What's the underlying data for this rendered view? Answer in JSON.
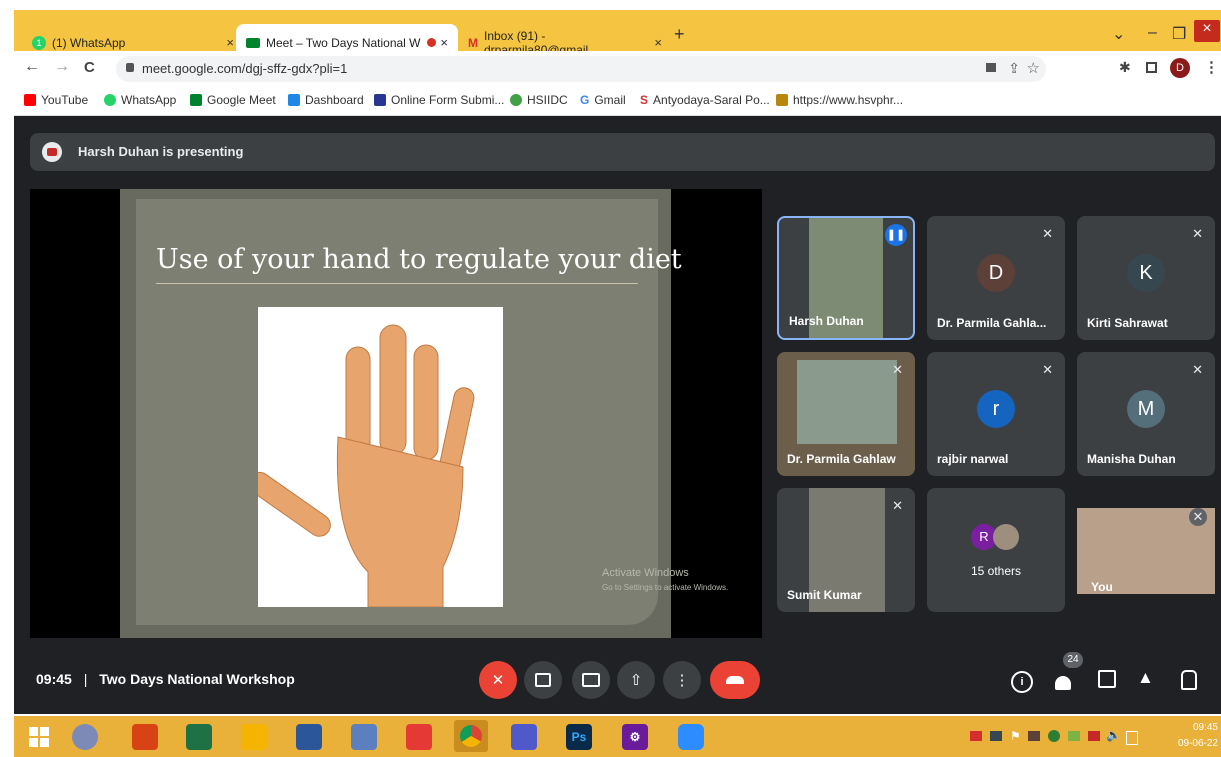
{
  "tabs": [
    {
      "label": "(1) WhatsApp",
      "badge": "1"
    },
    {
      "label": "Meet – Two Days National W"
    },
    {
      "label": "Inbox (91) - drparmila80@gmail."
    }
  ],
  "new_tab": "+",
  "close_glyph": "×",
  "window": {
    "minimize": "–",
    "restore": "❐",
    "close": "×",
    "dropdown": "⌄"
  },
  "nav": {
    "back": "←",
    "forward": "→",
    "reload": "C"
  },
  "address": "meet.google.com/dgj-sffz-gdx?pli=1",
  "profile_initial": "D",
  "bookmarks": [
    "YouTube",
    "WhatsApp",
    "Google Meet",
    "Dashboard",
    "Online Form Submi...",
    "HSIIDC",
    "Gmail",
    "Antyodaya-Saral Po...",
    "https://www.hsvphr..."
  ],
  "presenting": "Harsh Duhan is presenting",
  "slide": {
    "title": "Use of your hand to regulate your diet",
    "watermark_title": "Activate Windows",
    "watermark_sub": "Go to Settings to activate Windows."
  },
  "participants": [
    {
      "name": "Harsh Duhan",
      "type": "video",
      "speaking": true
    },
    {
      "name": "Dr. Parmila Gahla...",
      "initial": "D",
      "color": "#5d4037"
    },
    {
      "name": "Kirti Sahrawat",
      "initial": "K",
      "color": "#37474f"
    },
    {
      "name": "Dr. Parmila Gahlaw",
      "type": "video"
    },
    {
      "name": "rajbir narwal",
      "initial": "r",
      "color": "#1565c0"
    },
    {
      "name": "Manisha Duhan",
      "initial": "M",
      "color": "#546e7a"
    },
    {
      "name": "Sumit Kumar",
      "type": "video"
    },
    {
      "name": "15 others",
      "initial": "R",
      "color": "#7b1fa2"
    },
    {
      "name": "You",
      "type": "video"
    }
  ],
  "bottom": {
    "time": "09:45",
    "separator": "|",
    "meeting_name": "Two Days National Workshop",
    "participant_count": "24"
  },
  "taskbar": {
    "clock_time": "09:45",
    "clock_date": "09-06-22",
    "ps_label": "Ps"
  },
  "colors": {
    "title_bar": "#f5c542",
    "meet_bg": "#202124",
    "end_call": "#ea4335",
    "taskbar": "#e9b13a"
  }
}
